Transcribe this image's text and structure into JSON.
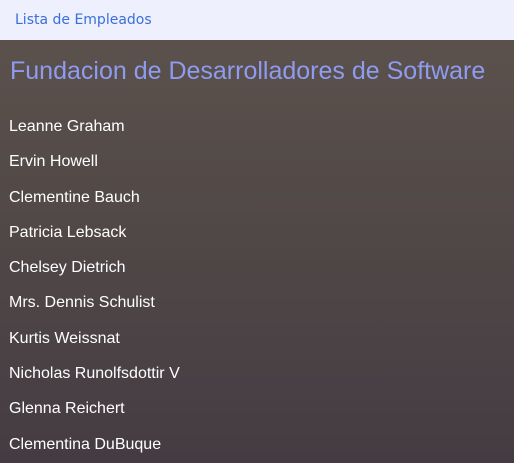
{
  "header": {
    "nav_link": "Lista de Empleados"
  },
  "main": {
    "title": "Fundacion de Desarrolladores de Software",
    "employees": [
      "Leanne Graham",
      "Ervin Howell",
      "Clementine Bauch",
      "Patricia Lebsack",
      "Chelsey Dietrich",
      "Mrs. Dennis Schulist",
      "Kurtis Weissnat",
      "Nicholas Runolfsdottir V",
      "Glenna Reichert",
      "Clementina DuBuque"
    ]
  },
  "colors": {
    "topbar_background": "#eef0fe",
    "link": "#3a6fd8",
    "title": "#8f9bf0",
    "list_text": "#ffffff",
    "main_background_top": "#5b514c",
    "main_background_bottom": "#443c42"
  }
}
